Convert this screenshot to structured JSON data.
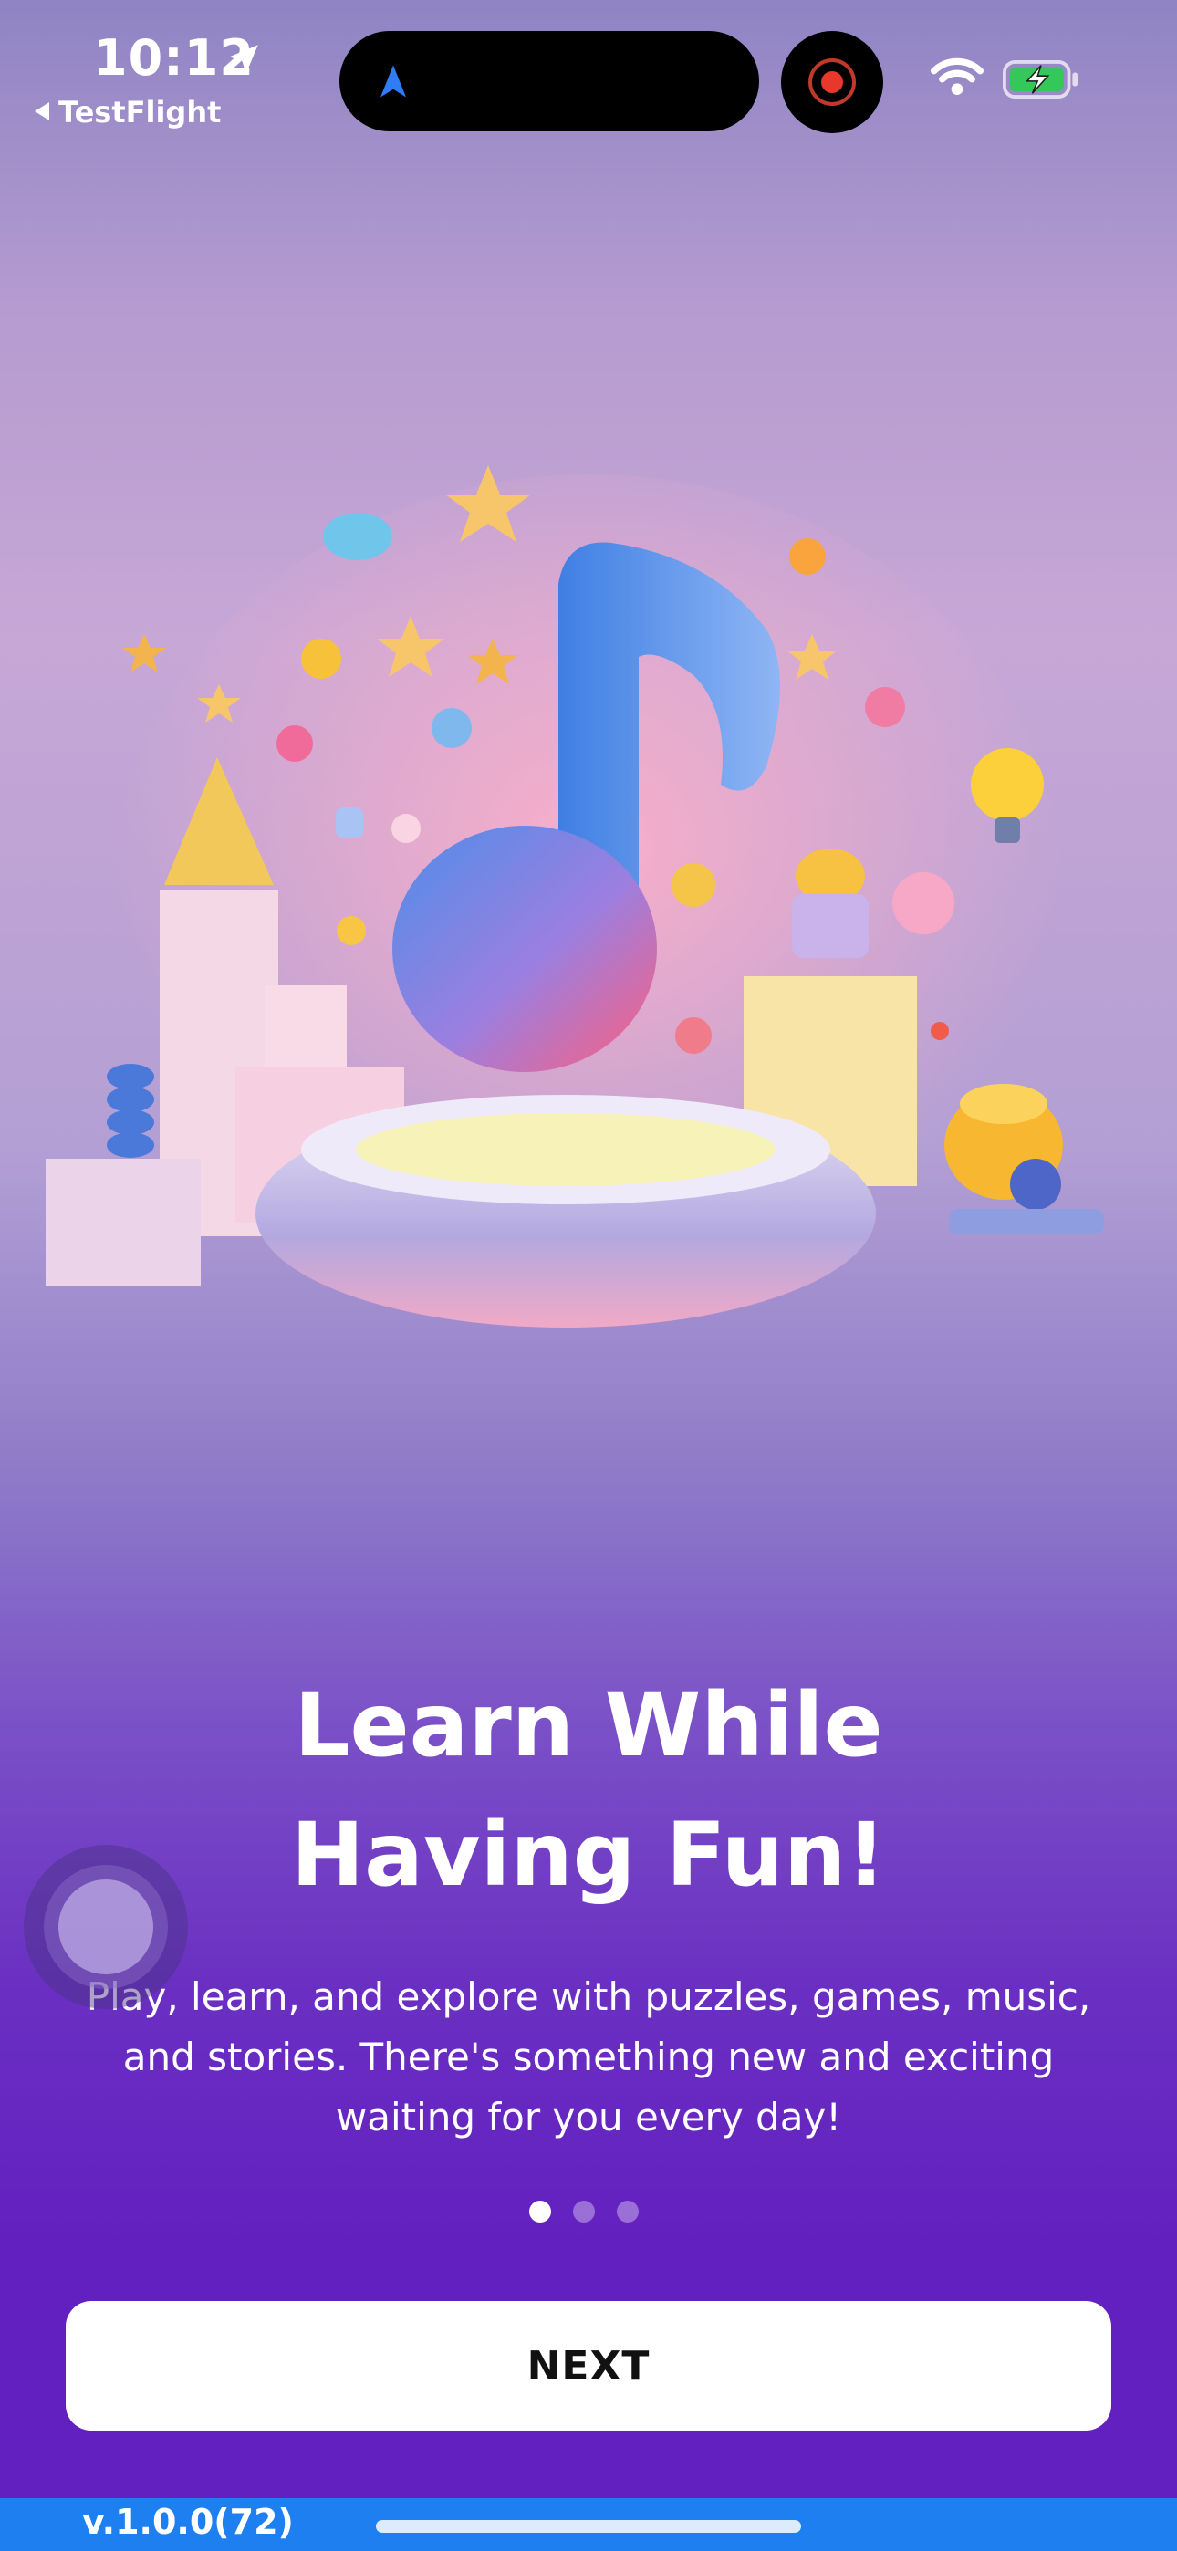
{
  "status_bar": {
    "time": "10:12",
    "back_app": "TestFlight",
    "icons": [
      "location-arrow-icon",
      "navigation-icon",
      "screen-recording-icon",
      "wifi-icon",
      "battery-charging-icon"
    ]
  },
  "onboarding": {
    "title_line1": "Learn While",
    "title_line2": "Having Fun!",
    "description": "Play, learn, and explore with puzzles, games, music, and stories. There's something new and exciting waiting for you every day!",
    "page_count": 3,
    "active_page": 1,
    "next_label": "NEXT"
  },
  "footer": {
    "version": "v.1.0.0(72)"
  },
  "colors": {
    "accent_purple": "#6320c0",
    "footer_blue": "#1e7ff0",
    "button_bg": "#ffffff"
  }
}
